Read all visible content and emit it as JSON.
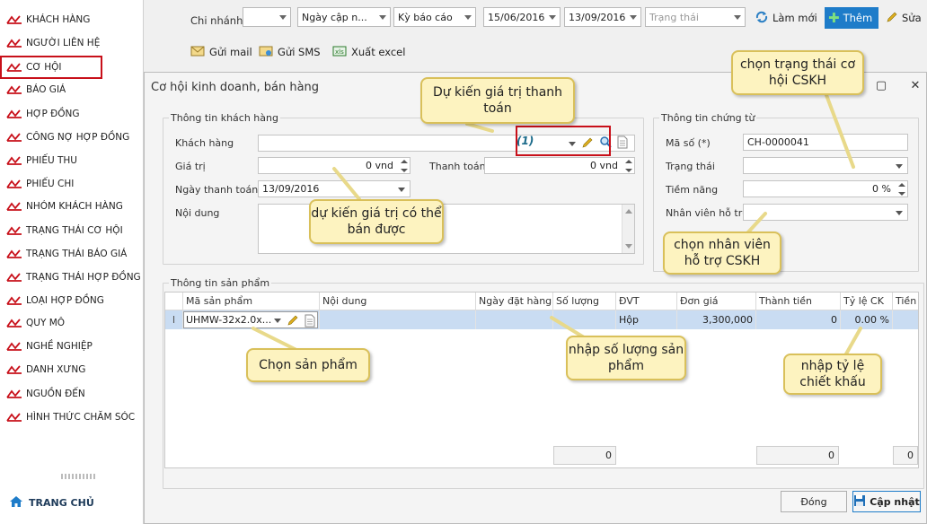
{
  "sidebar": {
    "items": [
      {
        "label": "KHÁCH HÀNG"
      },
      {
        "label": "NGƯỜI LIÊN HỆ"
      },
      {
        "label": "CƠ HỘI"
      },
      {
        "label": "BÁO GIÁ"
      },
      {
        "label": "HỢP ĐỒNG"
      },
      {
        "label": "CÔNG NỢ HỢP ĐỒNG"
      },
      {
        "label": "PHIẾU THU"
      },
      {
        "label": "PHIẾU CHI"
      },
      {
        "label": "NHÓM KHÁCH HÀNG"
      },
      {
        "label": "TRẠNG THÁI CƠ HỘI"
      },
      {
        "label": "TRẠNG THÁI BÁO GIÁ"
      },
      {
        "label": "TRẠNG THÁI HỢP ĐỒNG"
      },
      {
        "label": "LOẠI HỢP ĐỒNG"
      },
      {
        "label": "QUY MÔ"
      },
      {
        "label": "NGHỀ NGHIỆP"
      },
      {
        "label": "DANH XƯNG"
      },
      {
        "label": "NGUỒN ĐẾN"
      },
      {
        "label": "HÌNH THỨC CHĂM SÓC"
      }
    ],
    "home": "TRANG CHỦ"
  },
  "toolbar": {
    "branch_label": "Chi nhánh",
    "branch_value": "",
    "date_field": "Ngày cập n...",
    "period": "Kỳ báo cáo",
    "from_date": "15/06/2016",
    "to_date": "13/09/2016",
    "status_placeholder": "Trạng thái",
    "refresh": "Làm mới",
    "add": "Thêm",
    "edit": "Sửa",
    "mail": "Gửi mail",
    "sms": "Gửi SMS",
    "excel": "Xuất excel"
  },
  "dialog": {
    "title": "Cơ hội kinh doanh, bán hàng",
    "customer_section": "Thông tin khách hàng",
    "customer_label": "Khách hàng",
    "customer_value": "",
    "value_label": "Giá trị",
    "value": "0 vnd",
    "payment_label": "Thanh toán",
    "payment_value": "0 vnd",
    "pay_date_label": "Ngày thanh toán",
    "pay_date": "13/09/2016",
    "content_label": "Nội dung",
    "doc_section": "Thông tin chứng từ",
    "code_label": "Mã số (*)",
    "code": "CH-0000041",
    "status_label": "Trạng thái",
    "potential_label": "Tiềm năng",
    "potential": "0 %",
    "staff_label": "Nhân viên hỗ trợ",
    "product_section": "Thông tin sản phẩm",
    "close": "Đóng",
    "update": "Cập nhật",
    "marker": "(1)"
  },
  "grid": {
    "columns": [
      "Mã sản phẩm",
      "Nội dung",
      "Ngày đặt hàng",
      "Số lượng",
      "ĐVT",
      "Đơn giá",
      "Thành tiền",
      "Tỷ lệ CK",
      "Tiền C"
    ],
    "row": {
      "code": "UHMW-32x2.0x...",
      "content": "",
      "order_date": "",
      "qty": "",
      "unit": "Hộp",
      "price": "3,300,000",
      "amount": "0",
      "discount": "0.00 %",
      "disc_amount": ""
    },
    "footer": {
      "qty": "0",
      "amount": "0",
      "disc": "0"
    }
  },
  "callouts": {
    "payment": "Dự kiến giá trị thanh toán",
    "value": "dự kiến giá trị có thể bán được",
    "status": "chọn trạng thái cơ hội CSKH",
    "staff": "chọn nhân viên hỗ trợ CSKH",
    "product": "Chọn sản phẩm",
    "qty": "nhập số lượng sản phẩm",
    "discount": "nhập tỷ lệ chiết khấu"
  },
  "colors": {
    "accent": "#1e7cc9",
    "highlight": "#c8101a",
    "callout": "#fdf3c0",
    "row_selected": "#c9dcf2"
  }
}
